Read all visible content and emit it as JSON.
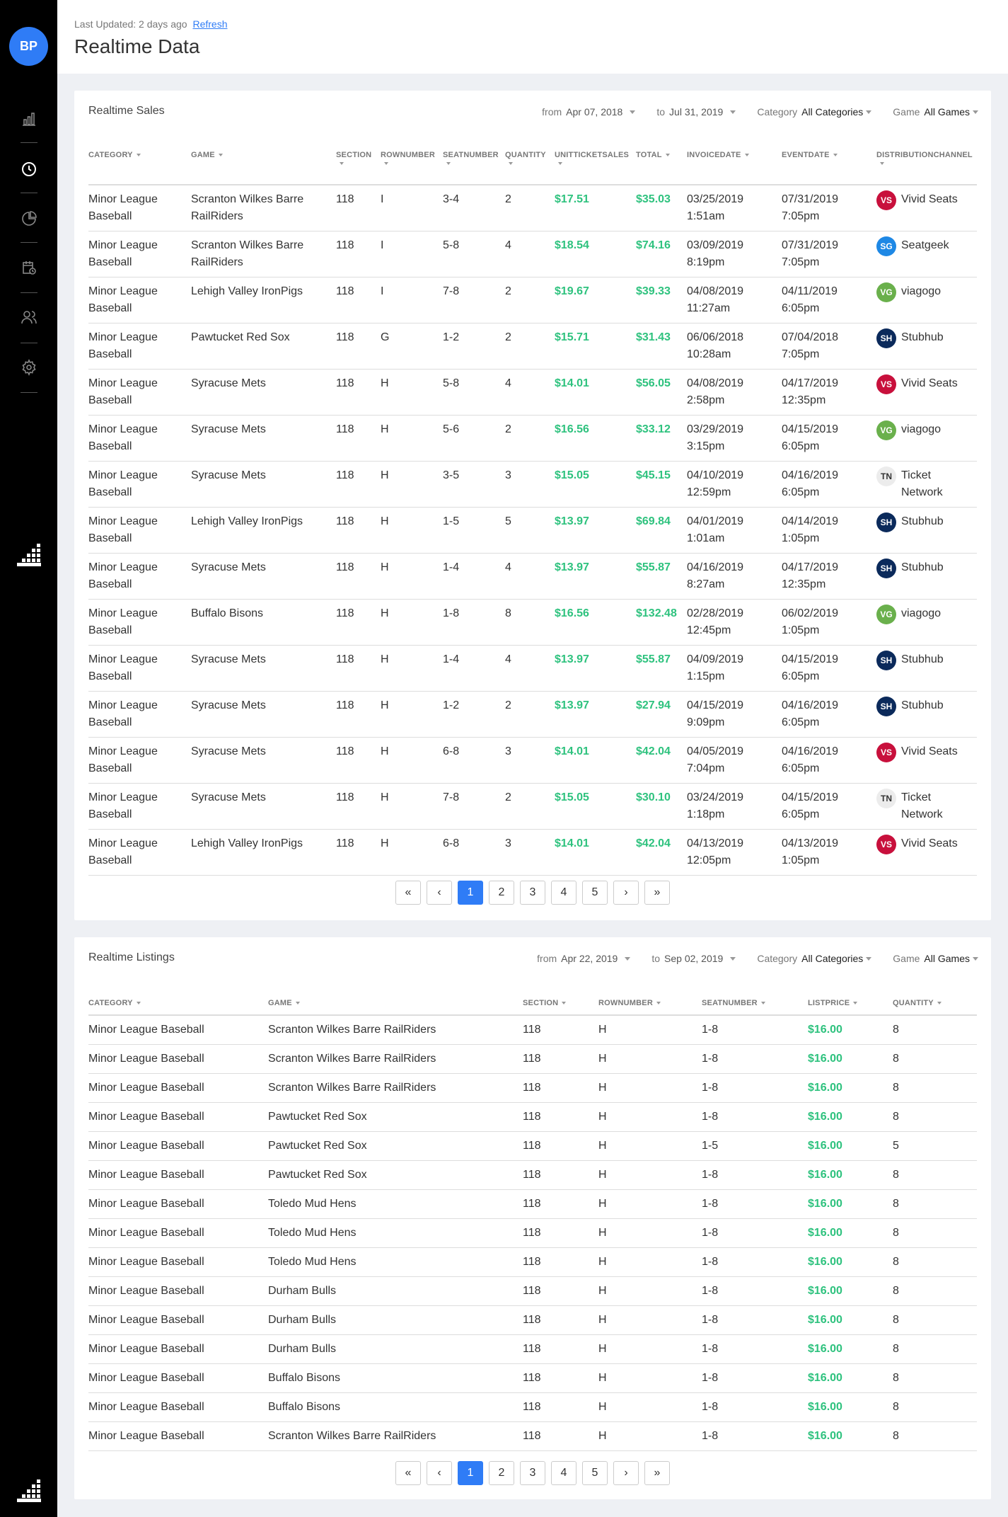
{
  "user": {
    "initials": "BP"
  },
  "header": {
    "updated_text": "Last Updated: 2 days ago",
    "refresh_label": "Refresh",
    "title": "Realtime Data"
  },
  "colors": {
    "accent": "#2f7cf6",
    "money": "#2ec27e",
    "vivid_seats": "#c8103c",
    "seatgeek": "#1e88e5",
    "viagogo": "#6ab04c",
    "stubhub": "#0b2a5b",
    "ticket_network": "#ececec"
  },
  "sales": {
    "title": "Realtime Sales",
    "filters": {
      "from_label": "from",
      "from_value": "Apr 07, 2018",
      "to_label": "to",
      "to_value": "Jul 31, 2019",
      "category_label": "Category",
      "category_value": "All Categories",
      "game_label": "Game",
      "game_value": "All Games"
    },
    "columns": [
      "CATEGORY",
      "GAME",
      "SECTION",
      "ROWNUMBER",
      "SEATNUMBER",
      "QUANTITY",
      "UNITTICKETSALES",
      "TOTAL",
      "INVOICEDATE",
      "EVENTDATE",
      "DISTRIBUTIONCHANNEL"
    ],
    "rows": [
      [
        "Minor League Baseball",
        "Scranton Wilkes Barre RailRiders",
        "118",
        "I",
        "3-4",
        "2",
        "$17.51",
        "$35.03",
        "03/25/2019 1:51am",
        "07/31/2019 7:05pm",
        "VS",
        "Vivid Seats"
      ],
      [
        "Minor League Baseball",
        "Scranton Wilkes Barre RailRiders",
        "118",
        "I",
        "5-8",
        "4",
        "$18.54",
        "$74.16",
        "03/09/2019 8:19pm",
        "07/31/2019 7:05pm",
        "SG",
        "Seatgeek"
      ],
      [
        "Minor League Baseball",
        "Lehigh Valley IronPigs",
        "118",
        "I",
        "7-8",
        "2",
        "$19.67",
        "$39.33",
        "04/08/2019 11:27am",
        "04/11/2019 6:05pm",
        "VG",
        "viagogo"
      ],
      [
        "Minor League Baseball",
        "Pawtucket Red Sox",
        "118",
        "G",
        "1-2",
        "2",
        "$15.71",
        "$31.43",
        "06/06/2018 10:28am",
        "07/04/2018 7:05pm",
        "SH",
        "Stubhub"
      ],
      [
        "Minor League Baseball",
        "Syracuse Mets",
        "118",
        "H",
        "5-8",
        "4",
        "$14.01",
        "$56.05",
        "04/08/2019 2:58pm",
        "04/17/2019 12:35pm",
        "VS",
        "Vivid Seats"
      ],
      [
        "Minor League Baseball",
        "Syracuse Mets",
        "118",
        "H",
        "5-6",
        "2",
        "$16.56",
        "$33.12",
        "03/29/2019 3:15pm",
        "04/15/2019 6:05pm",
        "VG",
        "viagogo"
      ],
      [
        "Minor League Baseball",
        "Syracuse Mets",
        "118",
        "H",
        "3-5",
        "3",
        "$15.05",
        "$45.15",
        "04/10/2019 12:59pm",
        "04/16/2019 6:05pm",
        "TN",
        "Ticket Network"
      ],
      [
        "Minor League Baseball",
        "Lehigh Valley IronPigs",
        "118",
        "H",
        "1-5",
        "5",
        "$13.97",
        "$69.84",
        "04/01/2019 1:01am",
        "04/14/2019 1:05pm",
        "SH",
        "Stubhub"
      ],
      [
        "Minor League Baseball",
        "Syracuse Mets",
        "118",
        "H",
        "1-4",
        "4",
        "$13.97",
        "$55.87",
        "04/16/2019 8:27am",
        "04/17/2019 12:35pm",
        "SH",
        "Stubhub"
      ],
      [
        "Minor League Baseball",
        "Buffalo Bisons",
        "118",
        "H",
        "1-8",
        "8",
        "$16.56",
        "$132.48",
        "02/28/2019 12:45pm",
        "06/02/2019 1:05pm",
        "VG",
        "viagogo"
      ],
      [
        "Minor League Baseball",
        "Syracuse Mets",
        "118",
        "H",
        "1-4",
        "4",
        "$13.97",
        "$55.87",
        "04/09/2019 1:15pm",
        "04/15/2019 6:05pm",
        "SH",
        "Stubhub"
      ],
      [
        "Minor League Baseball",
        "Syracuse Mets",
        "118",
        "H",
        "1-2",
        "2",
        "$13.97",
        "$27.94",
        "04/15/2019 9:09pm",
        "04/16/2019 6:05pm",
        "SH",
        "Stubhub"
      ],
      [
        "Minor League Baseball",
        "Syracuse Mets",
        "118",
        "H",
        "6-8",
        "3",
        "$14.01",
        "$42.04",
        "04/05/2019 7:04pm",
        "04/16/2019 6:05pm",
        "VS",
        "Vivid Seats"
      ],
      [
        "Minor League Baseball",
        "Syracuse Mets",
        "118",
        "H",
        "7-8",
        "2",
        "$15.05",
        "$30.10",
        "03/24/2019 1:18pm",
        "04/15/2019 6:05pm",
        "TN",
        "Ticket Network"
      ],
      [
        "Minor League Baseball",
        "Lehigh Valley IronPigs",
        "118",
        "H",
        "6-8",
        "3",
        "$14.01",
        "$42.04",
        "04/13/2019 12:05pm",
        "04/13/2019 1:05pm",
        "VS",
        "Vivid Seats"
      ]
    ]
  },
  "listings": {
    "title": "Realtime Listings",
    "filters": {
      "from_label": "from",
      "from_value": "Apr 22, 2019",
      "to_label": "to",
      "to_value": "Sep 02, 2019",
      "category_label": "Category",
      "category_value": "All Categories",
      "game_label": "Game",
      "game_value": "All Games"
    },
    "columns": [
      "CATEGORY",
      "GAME",
      "SECTION",
      "ROWNUMBER",
      "SEATNUMBER",
      "LISTPRICE",
      "QUANTITY"
    ],
    "rows": [
      [
        "Minor League Baseball",
        "Scranton Wilkes Barre RailRiders",
        "118",
        "H",
        "1-8",
        "$16.00",
        "8"
      ],
      [
        "Minor League Baseball",
        "Scranton Wilkes Barre RailRiders",
        "118",
        "H",
        "1-8",
        "$16.00",
        "8"
      ],
      [
        "Minor League Baseball",
        "Scranton Wilkes Barre RailRiders",
        "118",
        "H",
        "1-8",
        "$16.00",
        "8"
      ],
      [
        "Minor League Baseball",
        "Pawtucket Red Sox",
        "118",
        "H",
        "1-8",
        "$16.00",
        "8"
      ],
      [
        "Minor League Baseball",
        "Pawtucket Red Sox",
        "118",
        "H",
        "1-5",
        "$16.00",
        "5"
      ],
      [
        "Minor League Baseball",
        "Pawtucket Red Sox",
        "118",
        "H",
        "1-8",
        "$16.00",
        "8"
      ],
      [
        "Minor League Baseball",
        "Toledo Mud Hens",
        "118",
        "H",
        "1-8",
        "$16.00",
        "8"
      ],
      [
        "Minor League Baseball",
        "Toledo Mud Hens",
        "118",
        "H",
        "1-8",
        "$16.00",
        "8"
      ],
      [
        "Minor League Baseball",
        "Toledo Mud Hens",
        "118",
        "H",
        "1-8",
        "$16.00",
        "8"
      ],
      [
        "Minor League Baseball",
        "Durham Bulls",
        "118",
        "H",
        "1-8",
        "$16.00",
        "8"
      ],
      [
        "Minor League Baseball",
        "Durham Bulls",
        "118",
        "H",
        "1-8",
        "$16.00",
        "8"
      ],
      [
        "Minor League Baseball",
        "Durham Bulls",
        "118",
        "H",
        "1-8",
        "$16.00",
        "8"
      ],
      [
        "Minor League Baseball",
        "Buffalo Bisons",
        "118",
        "H",
        "1-8",
        "$16.00",
        "8"
      ],
      [
        "Minor League Baseball",
        "Buffalo Bisons",
        "118",
        "H",
        "1-8",
        "$16.00",
        "8"
      ],
      [
        "Minor League Baseball",
        "Scranton Wilkes Barre RailRiders",
        "118",
        "H",
        "1-8",
        "$16.00",
        "8"
      ]
    ]
  },
  "pagination": {
    "first": "«",
    "prev": "‹",
    "pages": [
      "1",
      "2",
      "3",
      "4",
      "5"
    ],
    "current": "1",
    "next": "›",
    "last": "»"
  },
  "nav_icons": [
    "bar-chart-icon",
    "clock-icon",
    "pie-chart-icon",
    "calendar-icon",
    "users-icon",
    "gear-icon"
  ]
}
